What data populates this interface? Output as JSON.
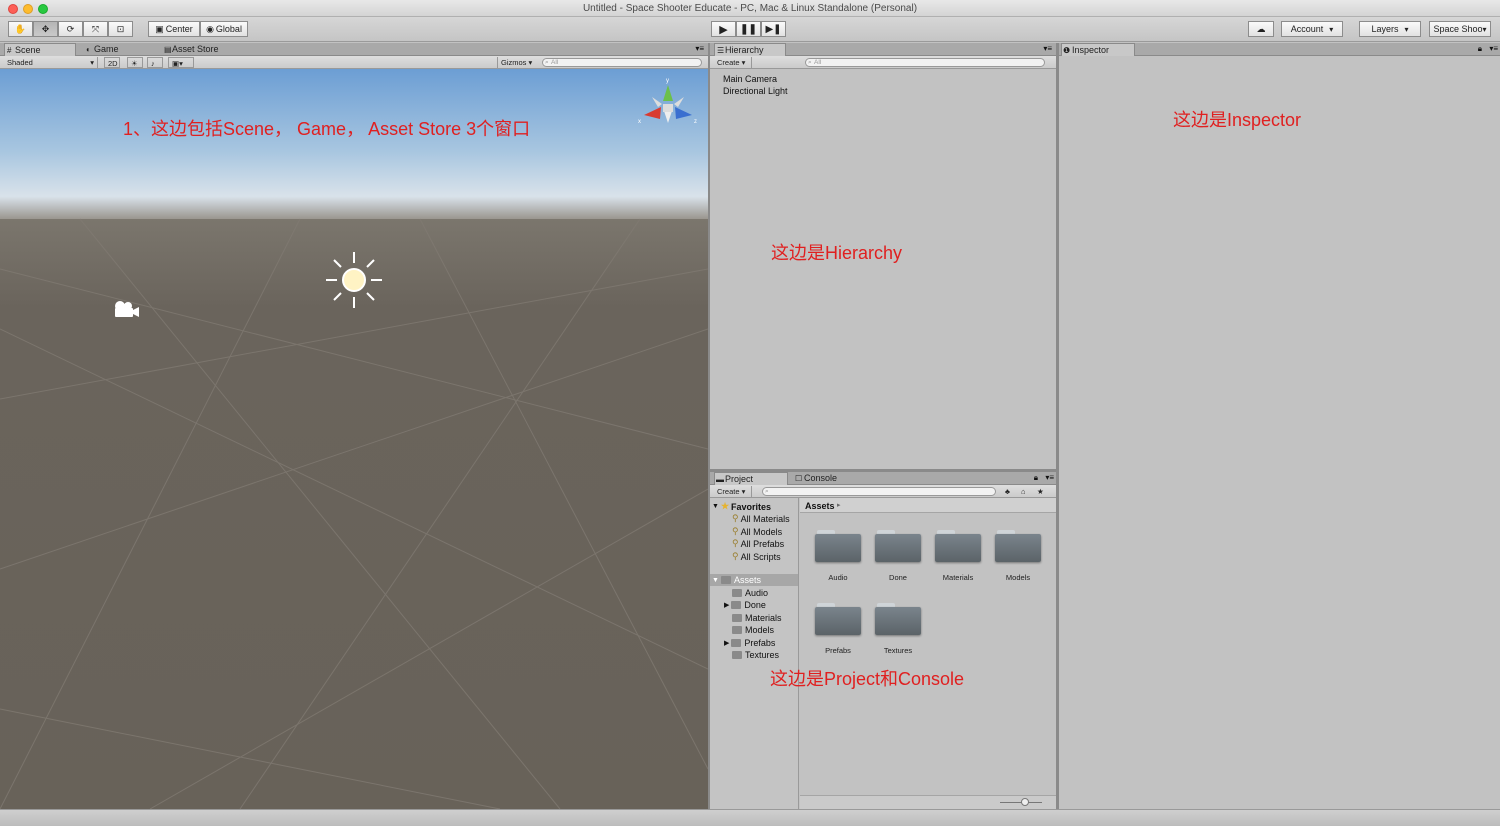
{
  "window": {
    "title": "Untitled - Space Shooter Educate - PC, Mac & Linux Standalone (Personal)"
  },
  "toolbar": {
    "pivot_label": "Center",
    "space_label": "Global",
    "account_label": "Account",
    "layers_label": "Layers",
    "layout_label": "Space Shoo"
  },
  "scene": {
    "tabs": [
      "Scene",
      "Game",
      "Asset Store"
    ],
    "shading_mode": "Shaded",
    "mode_2d": "2D",
    "gizmos_label": "Gizmos",
    "search_placeholder": "All",
    "annotation": "1、这边包括Scene， Game， Asset Store 3个窗口"
  },
  "hierarchy": {
    "tab": "Hierarchy",
    "create_label": "Create",
    "search_placeholder": "All",
    "items": [
      "Main Camera",
      "Directional Light"
    ],
    "annotation": "这边是Hierarchy"
  },
  "inspector": {
    "tab": "Inspector",
    "annotation": "这边是Inspector"
  },
  "project": {
    "tabs": [
      "Project",
      "Console"
    ],
    "create_label": "Create",
    "favorites_label": "Favorites",
    "favorites": [
      "All Materials",
      "All Models",
      "All Prefabs",
      "All Scripts"
    ],
    "assets_label": "Assets",
    "asset_tree": [
      "Audio",
      "Done",
      "Materials",
      "Models",
      "Prefabs",
      "Textures"
    ],
    "breadcrumb": "Assets",
    "grid_folders": [
      "Audio",
      "Done",
      "Materials",
      "Models",
      "Prefabs",
      "Textures"
    ],
    "annotation": "这边是Project和Console"
  }
}
